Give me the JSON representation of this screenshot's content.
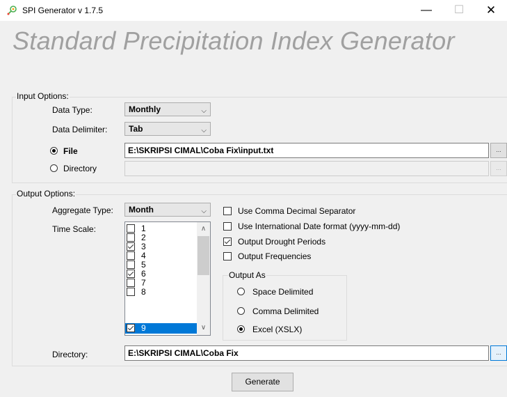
{
  "window": {
    "title": "SPI Generator  v 1.7.5",
    "minimize_glyph": "—",
    "maximize_glyph": "☐",
    "close_glyph": "✕"
  },
  "banner": "Standard Precipitation Index Generator",
  "input_options": {
    "group_title": "Input Options:",
    "data_type_label": "Data Type:",
    "data_type_value": "Monthly",
    "data_delimiter_label": "Data Delimiter:",
    "data_delimiter_value": "Tab",
    "file_label": "File",
    "file_path": "E:\\SKRIPSI CIMAL\\Coba Fix\\input.txt",
    "file_browse": "...",
    "directory_label": "Directory",
    "directory_path": "",
    "directory_browse": "...",
    "selected_source": "File"
  },
  "output_options": {
    "group_title": "Output Options:",
    "aggregate_type_label": "Aggregate Type:",
    "aggregate_type_value": "Month",
    "time_scale_label": "Time Scale:",
    "time_scale_items": [
      {
        "label": "1",
        "checked": false,
        "selected": false
      },
      {
        "label": "2",
        "checked": false,
        "selected": false
      },
      {
        "label": "3",
        "checked": true,
        "selected": false
      },
      {
        "label": "4",
        "checked": false,
        "selected": false
      },
      {
        "label": "5",
        "checked": false,
        "selected": false
      },
      {
        "label": "6",
        "checked": true,
        "selected": false
      },
      {
        "label": "7",
        "checked": false,
        "selected": false
      },
      {
        "label": "8",
        "checked": false,
        "selected": false
      },
      {
        "label": "9",
        "checked": true,
        "selected": true
      }
    ],
    "scroll_up_glyph": "∧",
    "scroll_down_glyph": "∨",
    "checkboxes": [
      {
        "label": "Use Comma Decimal Separator",
        "checked": false
      },
      {
        "label": "Use International Date format (yyyy-mm-dd)",
        "checked": false
      },
      {
        "label": "Output Drought Periods",
        "checked": true
      },
      {
        "label": "Output Frequencies",
        "checked": false
      }
    ],
    "output_as_title": "Output As",
    "output_as_options": [
      {
        "label": "Space Delimited",
        "checked": false
      },
      {
        "label": "Comma Delimited",
        "checked": false
      },
      {
        "label": "Excel (XSLX)",
        "checked": true
      }
    ],
    "directory_label": "Directory:",
    "directory_path": "E:\\SKRIPSI CIMAL\\Coba Fix",
    "directory_browse": "..."
  },
  "generate_label": "Generate",
  "combo_arrow_glyph": "⌵",
  "colors": {
    "selection": "#0078d7",
    "banner_text": "#a0a0a0",
    "window_bg": "#f0f0f0"
  }
}
